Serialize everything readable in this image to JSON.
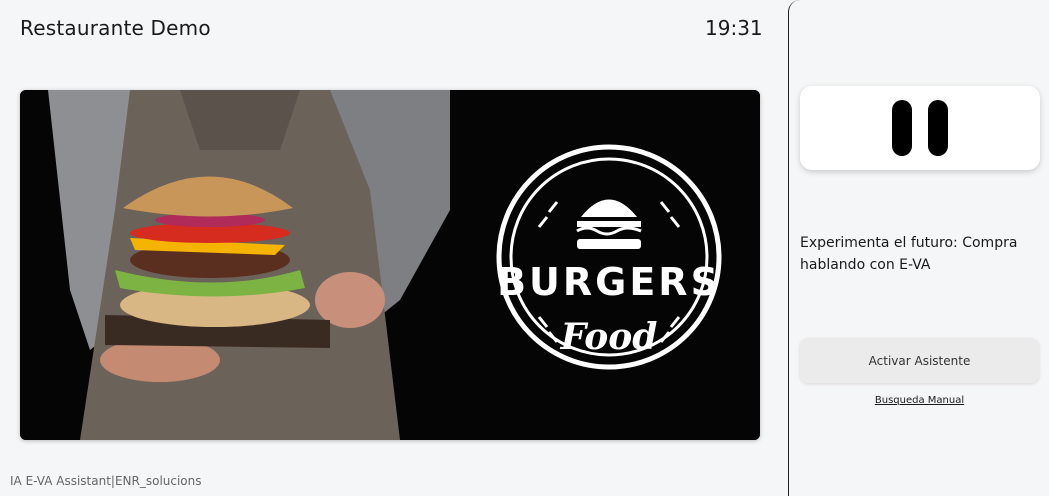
{
  "header": {
    "title": "Restaurante Demo",
    "time": "19:31"
  },
  "banner": {
    "brand_top": "BURGERS",
    "brand_bottom": "Food"
  },
  "footer": {
    "text": "IA E-VA Assistant|ENR_solucions"
  },
  "assistant": {
    "promo_text": "Experimenta el futuro:  Compra hablando con E-VA",
    "activate_label": "Activar Asistente",
    "manual_link": "Busqueda Manual",
    "status_icon": "pause-icon"
  }
}
